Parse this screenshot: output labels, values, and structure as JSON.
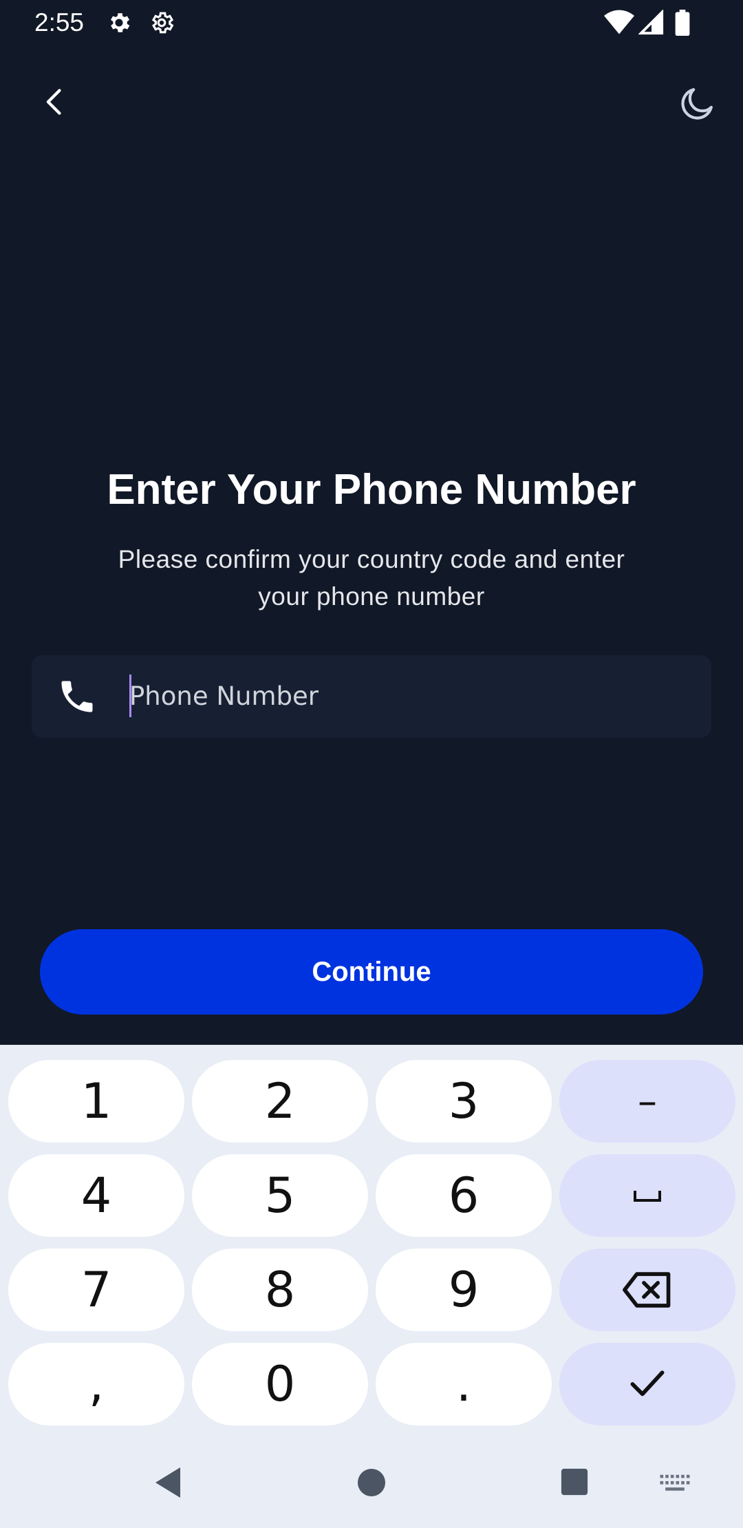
{
  "status_bar": {
    "time": "2:55",
    "icons": [
      "gear-icon",
      "gear-outline-icon",
      "wifi-icon",
      "signal-icon",
      "battery-icon"
    ]
  },
  "app_bar": {
    "back_icon": "chevron-left-icon",
    "theme_icon": "moon-icon"
  },
  "screen": {
    "title": "Enter Your Phone Number",
    "subtitle_line1": "Please confirm your country code and enter",
    "subtitle_line2": "your phone number",
    "phone_input": {
      "value": "",
      "placeholder": "Phone Number",
      "icon": "phone-icon"
    },
    "continue_label": "Continue"
  },
  "keyboard": {
    "keys": [
      [
        "1",
        "2",
        "3",
        "–"
      ],
      [
        "4",
        "5",
        "6",
        "space"
      ],
      [
        "7",
        "8",
        "9",
        "backspace"
      ],
      [
        ",",
        "0",
        ".",
        "done"
      ]
    ],
    "labels": {
      "k1": "1",
      "k2": "2",
      "k3": "3",
      "dash": "–",
      "k4": "4",
      "k5": "5",
      "k6": "6",
      "k7": "7",
      "k8": "8",
      "k9": "9",
      "comma": ",",
      "k0": "0",
      "period": "."
    }
  },
  "nav_bar": {
    "icons": [
      "back-triangle-icon",
      "home-circle-icon",
      "recents-square-icon",
      "keyboard-icon"
    ]
  },
  "colors": {
    "background": "#111827",
    "field": "#172033",
    "accent": "#0033e0",
    "keyboard_bg": "#e8edf6",
    "function_key": "#dde0fb"
  }
}
